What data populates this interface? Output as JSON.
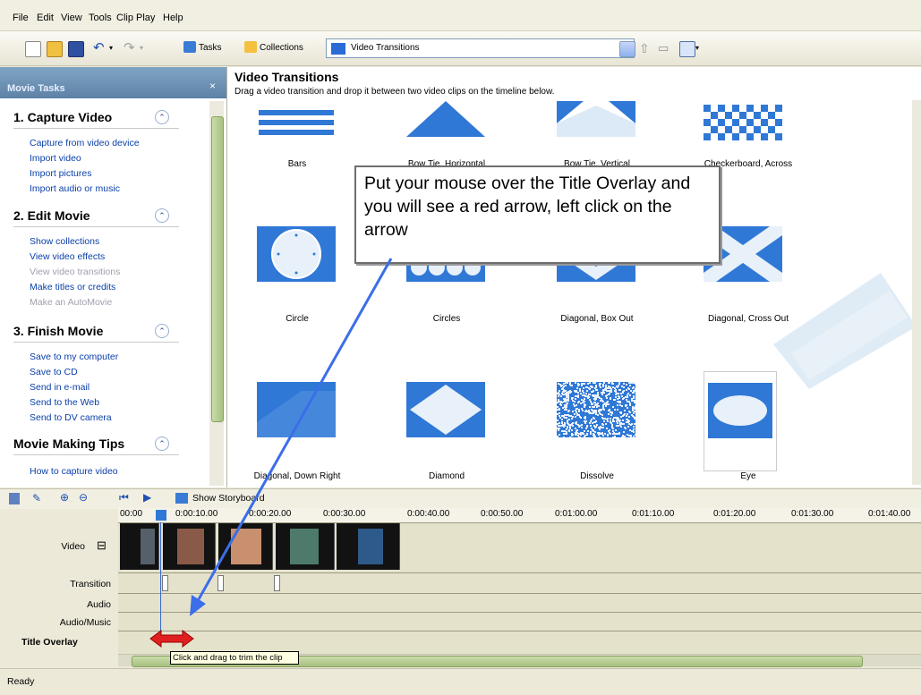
{
  "menu": [
    "File",
    "Edit",
    "View",
    "Tools",
    "Clip",
    "Play",
    "Help"
  ],
  "toolbar": {
    "tasks_label": "Tasks",
    "collections_label": "Collections",
    "collection_select": "Video Transitions"
  },
  "taskpane": {
    "header": "Movie Tasks",
    "close": "×",
    "sections": [
      {
        "title": "1. Capture Video",
        "toggle": "⌃",
        "links": [
          {
            "label": "Capture from video device",
            "enabled": true
          },
          {
            "label": "Import video",
            "enabled": true
          },
          {
            "label": "Import pictures",
            "enabled": true
          },
          {
            "label": "Import audio or music",
            "enabled": true
          }
        ]
      },
      {
        "title": "2. Edit Movie",
        "toggle": "⌃",
        "links": [
          {
            "label": "Show collections",
            "enabled": true
          },
          {
            "label": "View video effects",
            "enabled": true
          },
          {
            "label": "View video transitions",
            "enabled": false
          },
          {
            "label": "Make titles or credits",
            "enabled": true
          },
          {
            "label": "Make an AutoMovie",
            "enabled": false
          }
        ]
      },
      {
        "title": "3. Finish Movie",
        "toggle": "⌃",
        "links": [
          {
            "label": "Save to my computer",
            "enabled": true
          },
          {
            "label": "Save to CD",
            "enabled": true
          },
          {
            "label": "Send in e-mail",
            "enabled": true
          },
          {
            "label": "Send to the Web",
            "enabled": true
          },
          {
            "label": "Send to DV camera",
            "enabled": true
          }
        ]
      },
      {
        "title": "Movie Making Tips",
        "toggle": "⌃",
        "links": [
          {
            "label": "How to capture video",
            "enabled": true
          }
        ]
      }
    ]
  },
  "content": {
    "title": "Video Transitions",
    "description": "Drag a video transition and drop it between two video clips on the timeline below.",
    "transitions": [
      {
        "label": "Bars"
      },
      {
        "label": "Bow Tie, Horizontal"
      },
      {
        "label": "Bow Tie, Vertical"
      },
      {
        "label": "Checkerboard, Across"
      },
      {
        "label": "Circle"
      },
      {
        "label": "Circles"
      },
      {
        "label": "Diagonal, Box Out"
      },
      {
        "label": "Diagonal, Cross Out"
      },
      {
        "label": "Diagonal, Down Right"
      },
      {
        "label": "Diamond"
      },
      {
        "label": "Dissolve"
      },
      {
        "label": "Eye"
      }
    ]
  },
  "callout": {
    "text": "Put your mouse over the Title Overlay and you will see a red arrow, left click on the arrow"
  },
  "storyboard": {
    "show_storyboard_label": "Show Storyboard"
  },
  "timeline": {
    "ruler": [
      "00:00",
      "0:00:10.00",
      "0:00:20.00",
      "0:00:30.00",
      "0:00:40.00",
      "0:00:50.00",
      "0:01:00.00",
      "0:01:10.00",
      "0:01:20.00",
      "0:01:30.00",
      "0:01:40.00"
    ],
    "tracks": [
      "Video",
      "Transition",
      "Audio",
      "Audio/Music",
      "Title Overlay"
    ],
    "video_expand": "⊟",
    "tooltip": "Click and drag to trim the clip"
  },
  "status": "Ready",
  "colors": {
    "accent_blue": "#2f78d6",
    "link_blue": "#0a3fa8",
    "annotation_arrow": "#3b6ee8",
    "trim_arrow": "#e02020"
  }
}
